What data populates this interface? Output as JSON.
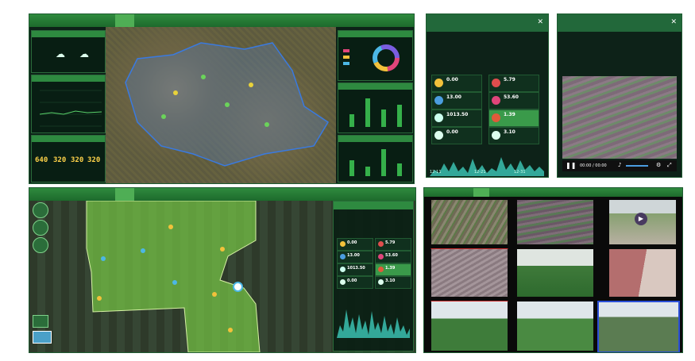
{
  "colors": {
    "brand_green": "#2f8a3e",
    "accent_yellow": "#ffd34a",
    "panel_dark": "#0d2218"
  },
  "dashboard_top": {
    "nav_tabs": [
      "",
      "",
      "",
      "",
      "",
      "",
      "",
      ""
    ],
    "kpis": [
      "640",
      "320",
      "320",
      "320"
    ]
  },
  "env_window": {
    "title": "",
    "sensors": [
      {
        "value": "0.00",
        "icon": "sun-icon"
      },
      {
        "value": "5.79",
        "icon": "thermometer-icon"
      },
      {
        "value": "13.00",
        "icon": "rain-icon"
      },
      {
        "value": "53.60",
        "icon": "droplet-icon"
      },
      {
        "value": "1013.50",
        "icon": "gauge-icon"
      },
      {
        "value": "1.39",
        "icon": "wind-icon"
      },
      {
        "value": "0.00",
        "icon": "cloud-icon"
      },
      {
        "value": "3.10",
        "icon": "compass-icon"
      }
    ],
    "time_labels": [
      "12-11",
      "12-21",
      "12-31"
    ]
  },
  "video_window": {
    "title": "",
    "time": "00:00 / 00:00",
    "section_label": ""
  },
  "dashboard_bottom": {
    "sensors": [
      {
        "value": "0.00"
      },
      {
        "value": "5.79"
      },
      {
        "value": "13.00"
      },
      {
        "value": "53.60"
      },
      {
        "value": "1013.50"
      },
      {
        "value": "1.39"
      },
      {
        "value": "0.00"
      },
      {
        "value": "3.10"
      }
    ]
  },
  "camera_wall": {
    "title": ""
  }
}
